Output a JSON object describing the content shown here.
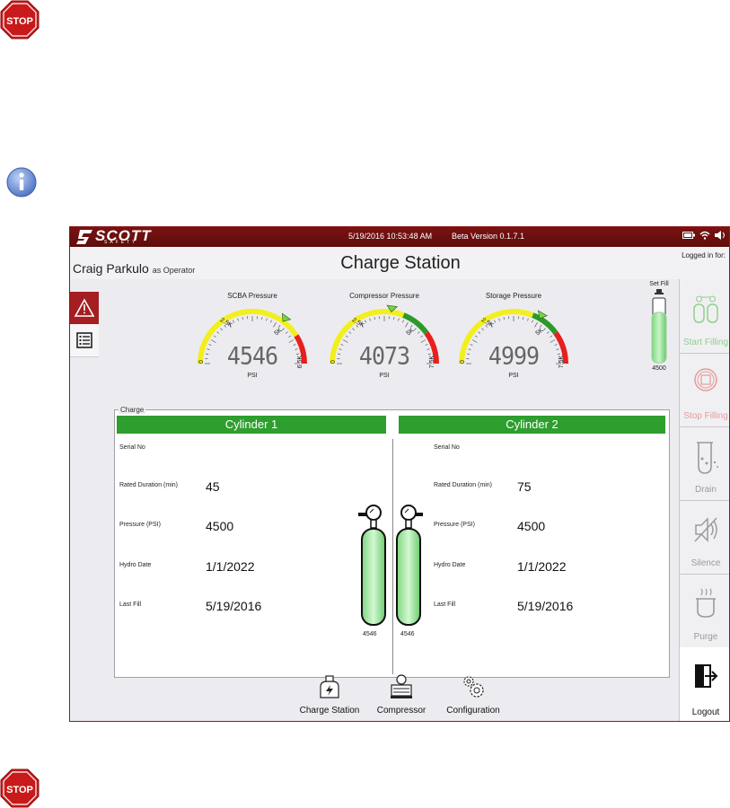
{
  "app": {
    "brand": "SCOTT",
    "brand_sub": "SAFETY",
    "datetime": "5/19/2016 10:53:48 AM",
    "version": "Beta Version 0.1.7.1"
  },
  "header": {
    "user_name": "Craig Parkulo",
    "user_role": "as Operator",
    "page_title": "Charge Station",
    "logged_in": "Logged in for:"
  },
  "gauges": [
    {
      "title": "SCBA Pressure",
      "value": "4546",
      "unit": "PSI",
      "ticks": [
        "0",
        "2.5K",
        "5K",
        "6.5K"
      ],
      "max": 6500,
      "reading": 4546
    },
    {
      "title": "Compressor Pressure",
      "value": "4073",
      "unit": "PSI",
      "ticks": [
        "0",
        "2.5K",
        "5K",
        "7.5K"
      ],
      "max": 7500,
      "reading": 4073
    },
    {
      "title": "Storage Pressure",
      "value": "4999",
      "unit": "PSI",
      "ticks": [
        "0",
        "2.5K",
        "5K",
        "7.5K"
      ],
      "max": 7500,
      "reading": 4999
    }
  ],
  "set_fill": {
    "label": "Set Fill",
    "value": "4500"
  },
  "charge": {
    "legend": "Charge",
    "cylinders": [
      {
        "name": "Cylinder 1",
        "serial_label": "Serial No",
        "rated_label": "Rated Duration (min)",
        "rated_value": "45",
        "pressure_label": "Pressure (PSI)",
        "pressure_value": "4500",
        "hydro_label": "Hydro Date",
        "hydro_value": "1/1/2022",
        "lastfill_label": "Last Fill",
        "lastfill_value": "5/19/2016",
        "tank_value": "4546"
      },
      {
        "name": "Cylinder 2",
        "serial_label": "Serial No",
        "rated_label": "Rated Duration (min)",
        "rated_value": "75",
        "pressure_label": "Pressure (PSI)",
        "pressure_value": "4500",
        "hydro_label": "Hydro Date",
        "hydro_value": "1/1/2022",
        "lastfill_label": "Last Fill",
        "lastfill_value": "5/19/2016",
        "tank_value": "4546"
      }
    ]
  },
  "sidebar": {
    "start": "Start Filling",
    "stop": "Stop Filling",
    "drain": "Drain",
    "silence": "Silence",
    "purge": "Purge",
    "logout": "Logout"
  },
  "bottom_nav": {
    "charge_station": "Charge Station",
    "compressor": "Compressor",
    "configuration": "Configuration"
  },
  "colors": {
    "titlebar": "#6b0f0f",
    "cylinder_header": "#2e9e2e",
    "alarm_tab": "#a41e22",
    "gauge_yellow": "#f2ef1f",
    "gauge_green": "#2a9a2a",
    "gauge_red": "#e81f1f"
  },
  "icons": {
    "stop": "stop-sign-icon",
    "info": "info-icon"
  }
}
